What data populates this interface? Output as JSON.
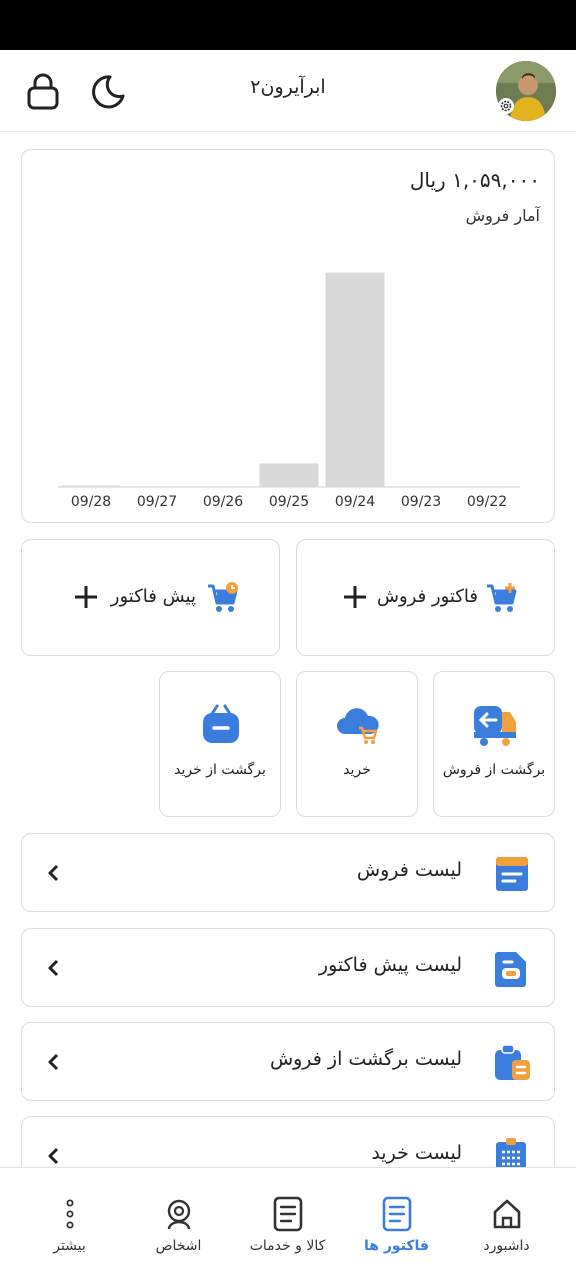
{
  "app": {
    "title": "ابرآیرون۲",
    "icons": {
      "lock": "lock-icon",
      "theme": "moon-icon",
      "settings": "gear-icon",
      "avatar": "user-avatar"
    }
  },
  "sales_chart": {
    "amount": "۱,۰۵۹,۰۰۰ ریال",
    "subtitle": "آمار فروش"
  },
  "chart_data": {
    "type": "bar",
    "categories": [
      "09/28",
      "09/27",
      "09/26",
      "09/25",
      "09/24",
      "09/23",
      "09/22"
    ],
    "values": [
      5000,
      0,
      0,
      110000,
      1000000,
      0,
      0
    ],
    "title": "آمار فروش",
    "xlabel": "",
    "ylabel": "",
    "ylim": [
      0,
      1059000
    ],
    "grid": false,
    "bar_color": "#d9d9d9"
  },
  "quick_actions": [
    {
      "label": "فاکتور فروش",
      "icon": "cart-plus-icon"
    },
    {
      "label": "پیش فاکتور",
      "icon": "cart-clock-icon"
    }
  ],
  "tiles": [
    {
      "label": "برگشت از فروش",
      "icon": "truck-return-icon"
    },
    {
      "label": "خرید",
      "icon": "cloud-cart-icon"
    },
    {
      "label": "برگشت از خرید",
      "icon": "basket-minus-icon"
    }
  ],
  "lists": [
    {
      "label": "لیست فروش",
      "icon": "document-list-icon"
    },
    {
      "label": "لیست پیش فاکتور",
      "icon": "document-pre-icon"
    },
    {
      "label": "لیست برگشت از فروش",
      "icon": "clipboard-return-icon"
    },
    {
      "label": "لیست خرید",
      "icon": "clipboard-list-icon"
    }
  ],
  "bottom_nav": [
    {
      "label": "داشبورد",
      "icon": "home-icon",
      "active": false
    },
    {
      "label": "فاکتور ها",
      "icon": "invoice-icon",
      "active": true
    },
    {
      "label": "کالا و خدمات",
      "icon": "product-icon",
      "active": false
    },
    {
      "label": "اشخاص",
      "icon": "people-icon",
      "active": false
    },
    {
      "label": "بیشتر",
      "icon": "more-icon",
      "active": false
    }
  ],
  "colors": {
    "accent_blue": "#3b7ddd",
    "accent_orange": "#f2a03d",
    "bar": "#d9d9d9",
    "border": "#dcdcdc"
  }
}
